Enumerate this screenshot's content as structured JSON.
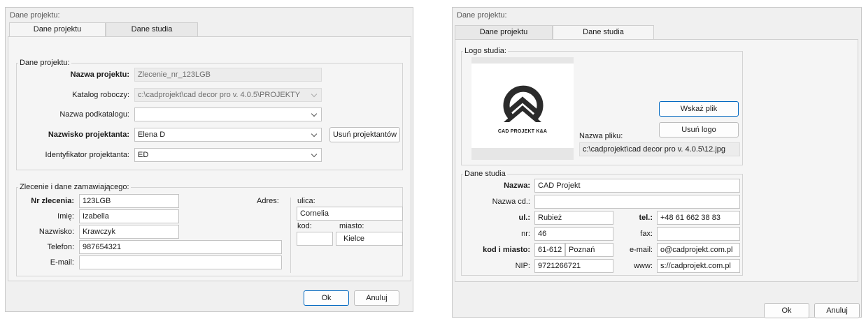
{
  "left": {
    "window_title": "Dane projektu:",
    "tabs": [
      "Dane projektu",
      "Dane studia"
    ],
    "group_project": {
      "title": "Dane projektu:",
      "nazwa_label": "Nazwa projektu:",
      "nazwa_value": "Zlecenie_nr_123LGB",
      "katalog_label": "Katalog roboczy:",
      "katalog_value": "c:\\cadprojekt\\cad decor pro v. 4.0.5\\PROJEKTY",
      "podkatalog_label": "Nazwa podkatalogu:",
      "podkatalog_value": "",
      "projektant_label": "Nazwisko projektanta:",
      "projektant_value": "Elena D",
      "usun_button": "Usuń projektantów",
      "identyfikator_label": "Identyfikator projektanta:",
      "identyfikator_value": "ED"
    },
    "group_order": {
      "title": "Zlecenie i dane zamawiającego:",
      "nr_label": "Nr zlecenia:",
      "nr_value": "123LGB",
      "imie_label": "Imię:",
      "imie_value": "Izabella",
      "nazwisko_label": "Nazwisko:",
      "nazwisko_value": "Krawczyk",
      "telefon_label": "Telefon:",
      "telefon_value": "987654321",
      "email_label": "E-mail:",
      "email_value": "",
      "adres_label": "Adres:",
      "ulica_label": "ulica:",
      "ulica_value": "Cornelia",
      "kod_label": "kod:",
      "kod_value": "",
      "miasto_label": "miasto:",
      "miasto_value": "Kielce"
    },
    "ok_button": "Ok",
    "cancel_button": "Anuluj"
  },
  "right": {
    "window_title": "Dane projektu:",
    "tabs": [
      "Dane projektu",
      "Dane studia"
    ],
    "logo_group": {
      "title": "Logo studia:",
      "logo_caption": "CAD PROJEKT K&A",
      "wskaz_button": "Wskaż plik",
      "usun_logo_button": "Usuń logo",
      "plik_label": "Nazwa pliku:",
      "plik_value": "c:\\cadprojekt\\cad decor pro v. 4.0.5\\12.jpg"
    },
    "studio_group": {
      "title": "Dane studia",
      "nazwa_label": "Nazwa:",
      "nazwa_value": "CAD Projekt",
      "nazwacd_label": "Nazwa cd.:",
      "nazwacd_value": "",
      "ul_label": "ul.:",
      "ul_value": "Rubież",
      "tel_label": "tel.:",
      "tel_value": "+48 61 662 38 83",
      "nr_label": "nr:",
      "nr_value": "46",
      "fax_label": "fax:",
      "fax_value": "",
      "kod_label": "kod i miasto:",
      "kod_value": "61-612",
      "miasto_value": "Poznań",
      "email_label": "e-mail:",
      "email_value": "o@cadprojekt.com.pl",
      "nip_label": "NIP:",
      "nip_value": "9721266721",
      "www_label": "www:",
      "www_value": "s://cadprojekt.com.pl"
    },
    "ok_button": "Ok",
    "cancel_button": "Anuluj"
  }
}
